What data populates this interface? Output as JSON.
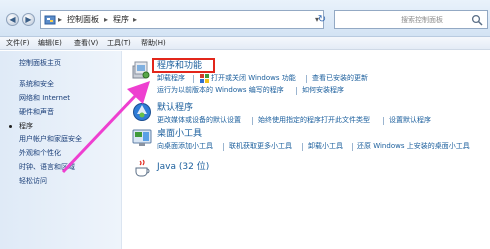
{
  "address_bar": {
    "crumbs": [
      "控制面板",
      "程序"
    ],
    "search_placeholder": "搜索控制面板"
  },
  "menu": {
    "items": [
      "文件(F)",
      "编辑(E)",
      "查看(V)",
      "工具(T)",
      "帮助(H)"
    ]
  },
  "sidebar": {
    "items": [
      "控制面板主页",
      "系统和安全",
      "网络和 Internet",
      "硬件和声音",
      "程序",
      "用户帐户和家庭安全",
      "外观和个性化",
      "时钟、语言和区域",
      "轻松访问"
    ],
    "active_item": "程序"
  },
  "sections": [
    {
      "title": "程序和功能",
      "icon": "programs-features-icon",
      "row1": [
        "卸载程序",
        "打开或关闭 Windows 功能",
        "查看已安装的更新"
      ],
      "row2": [
        "运行为以前版本的 Windows 编写的程序",
        "如何安装程序"
      ]
    },
    {
      "title": "默认程序",
      "icon": "default-programs-icon",
      "row1": [
        "更改媒体或设备的默认设置",
        "始终使用指定的程序打开此文件类型",
        "设置默认程序"
      ]
    },
    {
      "title": "桌面小工具",
      "icon": "desktop-gadgets-icon",
      "row1": [
        "向桌面添加小工具",
        "联机获取更多小工具",
        "卸载小工具",
        "还原 Windows 上安装的桌面小工具"
      ]
    },
    {
      "title": "Java (32 位)",
      "icon": "java-icon"
    }
  ],
  "colors": {
    "link": "#1a5e9c",
    "highlight_box": "#e2261b",
    "arrow": "#ee3fd0"
  }
}
